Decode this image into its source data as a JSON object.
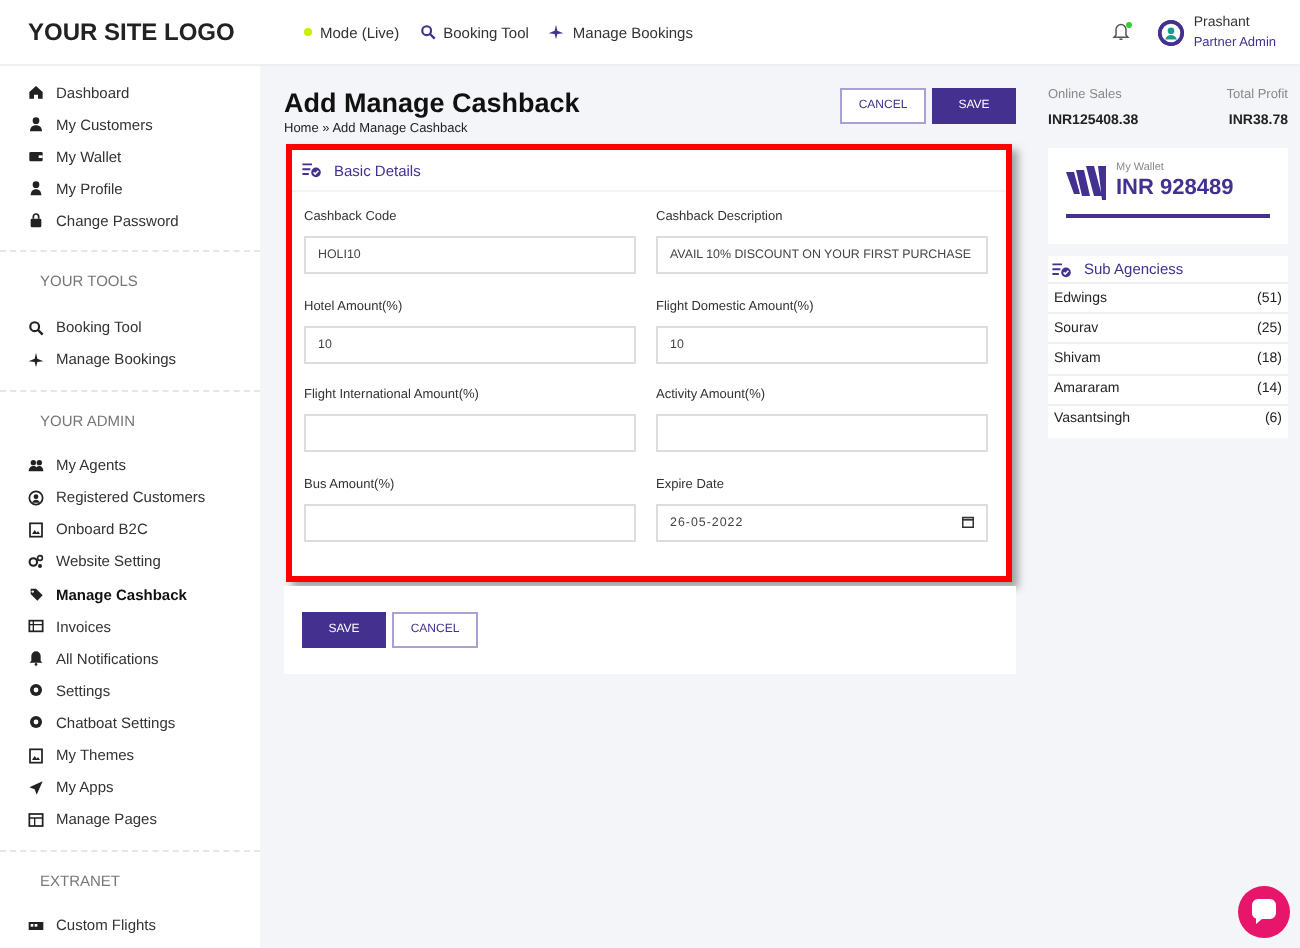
{
  "logo": "YOUR SITE LOGO",
  "topbar": {
    "links": [
      {
        "label": "Mode (Live)"
      },
      {
        "label": "Booking Tool"
      },
      {
        "label": "Manage Bookings"
      }
    ],
    "notifications": {
      "unread": true
    },
    "user": {
      "name": "Prashant",
      "role": "Partner Admin"
    }
  },
  "sidebar": {
    "sections": [
      {
        "items": [
          {
            "label": "Dashboard",
            "selected": false
          },
          {
            "label": "My Customers",
            "selected": false
          },
          {
            "label": "My Wallet",
            "selected": false
          },
          {
            "label": "My Profile",
            "selected": false
          },
          {
            "label": "Change Password",
            "selected": false
          }
        ]
      },
      {
        "heading": "YOUR TOOLS",
        "items": [
          {
            "label": "Booking Tool",
            "selected": false
          },
          {
            "label": "Manage Bookings",
            "selected": false
          }
        ]
      },
      {
        "heading": "YOUR ADMIN",
        "items": [
          {
            "label": "My Agents",
            "selected": false
          },
          {
            "label": "Registered Customers",
            "selected": false
          },
          {
            "label": "Onboard B2C",
            "selected": false
          },
          {
            "label": "Website Setting",
            "selected": false
          },
          {
            "label": "Manage Cashback",
            "selected": true
          },
          {
            "label": "Invoices",
            "selected": false
          },
          {
            "label": "All Notifications",
            "selected": false
          },
          {
            "label": "Settings",
            "selected": false
          },
          {
            "label": "Chatboat Settings",
            "selected": false
          },
          {
            "label": "My Themes",
            "selected": false
          },
          {
            "label": "My Apps",
            "selected": false
          },
          {
            "label": "Manage Pages",
            "selected": false
          }
        ]
      },
      {
        "heading": "EXTRANET",
        "items": [
          {
            "label": "Custom Flights",
            "selected": false
          }
        ]
      }
    ]
  },
  "page": {
    "title": "Add Manage Cashback",
    "breadcrumb": "Home » Add Manage Cashback",
    "buttons": [
      {
        "label": "CANCEL",
        "kind": "secondary"
      },
      {
        "label": "SAVE",
        "kind": "primary"
      }
    ]
  },
  "form": {
    "title": "Basic Details",
    "fields": [
      {
        "label": "Cashback Code",
        "value": "HOLI10",
        "kind": "text"
      },
      {
        "label": "Cashback Description",
        "value": "AVAIL 10% DISCOUNT ON YOUR FIRST PURCHASE",
        "kind": "text"
      },
      {
        "label": "Hotel Amount(%)",
        "value": "10",
        "kind": "text"
      },
      {
        "label": "Flight Domestic Amount(%)",
        "value": "10",
        "kind": "text"
      },
      {
        "label": "Flight International Amount(%)",
        "kind": "text"
      },
      {
        "label": "Activity Amount(%)",
        "kind": "text"
      },
      {
        "label": "Bus Amount(%)",
        "kind": "text"
      },
      {
        "label": "Expire Date",
        "value": "26-05-2022",
        "kind": "date"
      }
    ],
    "buttons": [
      {
        "label": "SAVE",
        "kind": "primary"
      },
      {
        "label": "CANCEL",
        "kind": "secondary"
      }
    ]
  },
  "stats": [
    {
      "label": "Online Sales",
      "value": "INR125408.38"
    },
    {
      "label": "Total Profit",
      "value": "INR38.78"
    }
  ],
  "wallet": {
    "label": "My Wallet",
    "amount": "INR 928489"
  },
  "sub_agencies": {
    "title": "Sub Agenciess",
    "items": [
      {
        "name": "Edwings",
        "count": "(51)"
      },
      {
        "name": "Sourav",
        "count": "(25)"
      },
      {
        "name": "Shivam",
        "count": "(18)"
      },
      {
        "name": "Amararam",
        "count": "(14)"
      },
      {
        "name": "Vasantsingh",
        "count": "(6)"
      }
    ]
  }
}
